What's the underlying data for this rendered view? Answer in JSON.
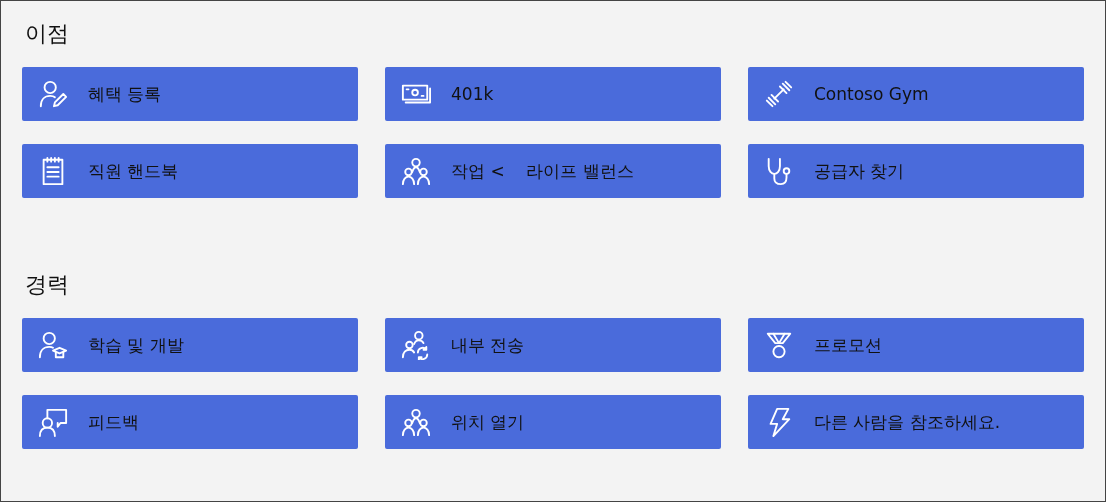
{
  "sections": [
    {
      "title": "이점",
      "links": [
        {
          "label": "혜택 등록",
          "kind": "enroll"
        },
        {
          "label": "401k",
          "kind": "money"
        },
        {
          "label": "Contoso Gym",
          "kind": "gym"
        },
        {
          "label": "직원 핸드북",
          "kind": "handbook"
        },
        {
          "label": "작업 <    라이프 밸런스",
          "kind": "group"
        },
        {
          "label": "공급자 찾기",
          "kind": "doctor"
        }
      ]
    },
    {
      "title": "경력",
      "links": [
        {
          "label": "학습 및 개발",
          "kind": "learning"
        },
        {
          "label": "내부 전송",
          "kind": "transfer"
        },
        {
          "label": "프로모션",
          "kind": "medal"
        },
        {
          "label": "피드백",
          "kind": "feedback"
        },
        {
          "label": "위치 열기",
          "kind": "group"
        },
        {
          "label": "다른 사람을 참조하세요.",
          "kind": "bolt"
        }
      ]
    }
  ]
}
